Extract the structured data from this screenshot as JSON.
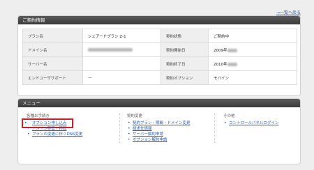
{
  "back_link": "一覧へ戻る",
  "contract": {
    "title": "ご契約情報",
    "rows": [
      {
        "label1": "プラン名",
        "value1": "シェアードプラン Z-1",
        "label2": "契約状態",
        "value2": "ご契約中"
      },
      {
        "label1": "ドメイン名",
        "value1": "",
        "label2": "契約開始日",
        "value2": "2009年"
      },
      {
        "label1": "サーバー名",
        "value1": "",
        "label2": "契約終了日",
        "value2": "2010年"
      },
      {
        "label1": "エンドユーザサポート",
        "value1": "—",
        "label2": "契約オプション",
        "value2": "モバイン"
      }
    ]
  },
  "menu": {
    "title": "メニュー",
    "columns": [
      {
        "heading": "各種お手続き",
        "items": [
          "オプション申し込み",
          "ドメイン移管・移転",
          "プランの変更に伴うDNS変更"
        ]
      },
      {
        "heading": "契約変更",
        "items": [
          "契約プラン・期間・ドメイン変更",
          "請求先情報",
          "サーバー解約申請",
          "オプション解約申請"
        ]
      },
      {
        "heading": "その他",
        "items": [
          "コントロールパネルログイン"
        ]
      }
    ]
  },
  "colors": {
    "link": "#2a5db0",
    "highlight": "#c9202b",
    "header_bg": "#3a3a3a"
  }
}
